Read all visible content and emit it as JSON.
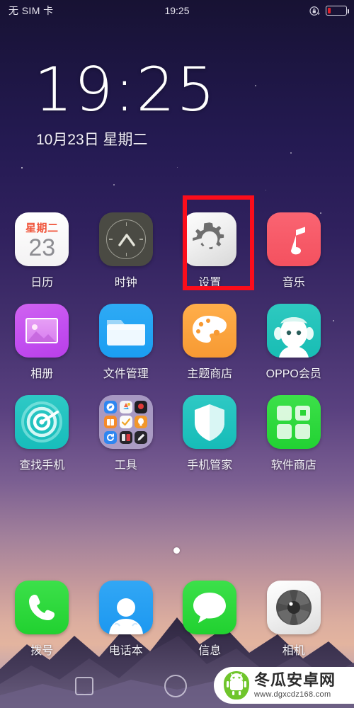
{
  "status_bar": {
    "carrier": "无 SIM 卡",
    "time": "19:25",
    "rotation_lock_icon": "rotation-lock-icon",
    "battery_icon": "battery-low-icon",
    "battery_level_percent": 18,
    "battery_color": "#e0212b"
  },
  "clock_widget": {
    "time": "19:25",
    "date": "10月23日 星期二"
  },
  "home_screen": {
    "page_indicator": {
      "total": 1,
      "current": 1
    },
    "rows": [
      {
        "apps": [
          {
            "label": "日历",
            "icon": "calendar-icon",
            "color": "#ffffff",
            "weekday": "星期二",
            "day": "23"
          },
          {
            "label": "时钟",
            "icon": "clock-icon",
            "color": "#4a4a43"
          },
          {
            "label": "设置",
            "icon": "settings-gear-icon",
            "color": "#f0f0f0",
            "highlighted": true
          },
          {
            "label": "音乐",
            "icon": "music-note-icon",
            "color": "#f4515f"
          }
        ]
      },
      {
        "apps": [
          {
            "label": "相册",
            "icon": "photos-icon",
            "color": "#c24ef0"
          },
          {
            "label": "文件管理",
            "icon": "file-folder-icon",
            "color": "#1b9ef2"
          },
          {
            "label": "主题商店",
            "icon": "theme-palette-icon",
            "color": "#f79a33"
          },
          {
            "label": "OPPO会员",
            "icon": "oppo-member-icon",
            "color": "#18bdb4"
          }
        ]
      },
      {
        "apps": [
          {
            "label": "查找手机",
            "icon": "find-phone-radar-icon",
            "color": "#17bdbb"
          },
          {
            "label": "工具",
            "icon": "tools-folder-icon",
            "color": "#beb2d6"
          },
          {
            "label": "手机管家",
            "icon": "phone-manager-shield-icon",
            "color": "#16bcb8"
          },
          {
            "label": "软件商店",
            "icon": "app-store-grid-icon",
            "color": "#22d233"
          }
        ]
      }
    ],
    "dock": {
      "apps": [
        {
          "label": "拨号",
          "icon": "phone-handset-icon",
          "color": "#21d130"
        },
        {
          "label": "电话本",
          "icon": "contacts-person-icon",
          "color": "#1c98f0"
        },
        {
          "label": "信息",
          "icon": "message-bubble-icon",
          "color": "#21d130"
        },
        {
          "label": "相机",
          "icon": "camera-aperture-icon",
          "color": "#dcdcdc"
        }
      ]
    }
  },
  "annotation": {
    "highlight_target": "设置",
    "highlight_color": "#fb0d1b"
  },
  "nav_bar": {
    "recent_icon": "recents-square-icon",
    "home_icon": "home-circle-icon"
  },
  "watermark": {
    "title": "冬瓜安卓网",
    "url": "www.dgxcdz168.com",
    "logo_icon": "winter-melon-android-logo"
  }
}
